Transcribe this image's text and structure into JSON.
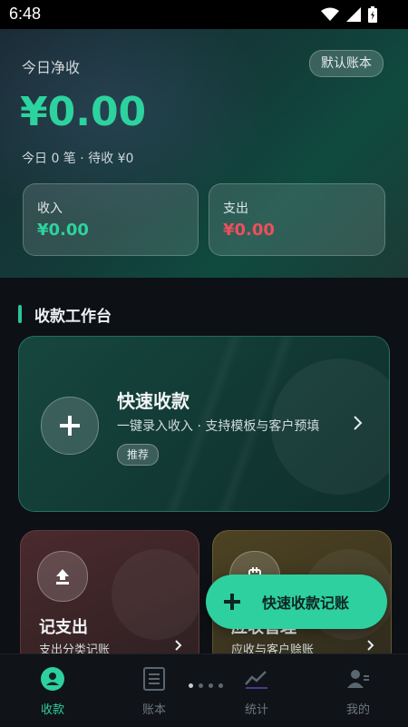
{
  "status_bar": {
    "time": "6:48",
    "icons": [
      "wifi-icon",
      "signal-icon",
      "battery-icon"
    ]
  },
  "hero": {
    "title": "今日净收",
    "account_chip": "默认账本",
    "amount": "¥0.00",
    "summary": "今日 0 笔 · 待收 ¥0",
    "income": {
      "label": "收入",
      "value": "¥0.00"
    },
    "expense": {
      "label": "支出",
      "value": "¥0.00"
    }
  },
  "workbench": {
    "title": "收款工作台",
    "quick_collect": {
      "title": "快速收款",
      "description": "一键录入收入 · 支持模板与客户预填",
      "tag": "推荐",
      "icon": "plus-icon"
    },
    "record_expense": {
      "title": "记支出",
      "subtitle": "支出分类记账",
      "icon": "upload-icon"
    },
    "receivables": {
      "title": "应收管理",
      "subtitle": "应收与客户赊账",
      "icon": "receipt-icon"
    }
  },
  "fab": {
    "label": "快速收款记账"
  },
  "bottom_nav": {
    "items": [
      {
        "label": "收款",
        "icon": "collect-icon",
        "active": true
      },
      {
        "label": "账本",
        "icon": "ledger-icon",
        "active": false
      },
      {
        "label": "统计",
        "icon": "chart-icon",
        "active": false
      },
      {
        "label": "我的",
        "icon": "profile-icon",
        "active": false
      }
    ]
  },
  "colors": {
    "accent": "#2ed0a0",
    "income": "#2dd39e",
    "expense": "#ef4e5c"
  }
}
